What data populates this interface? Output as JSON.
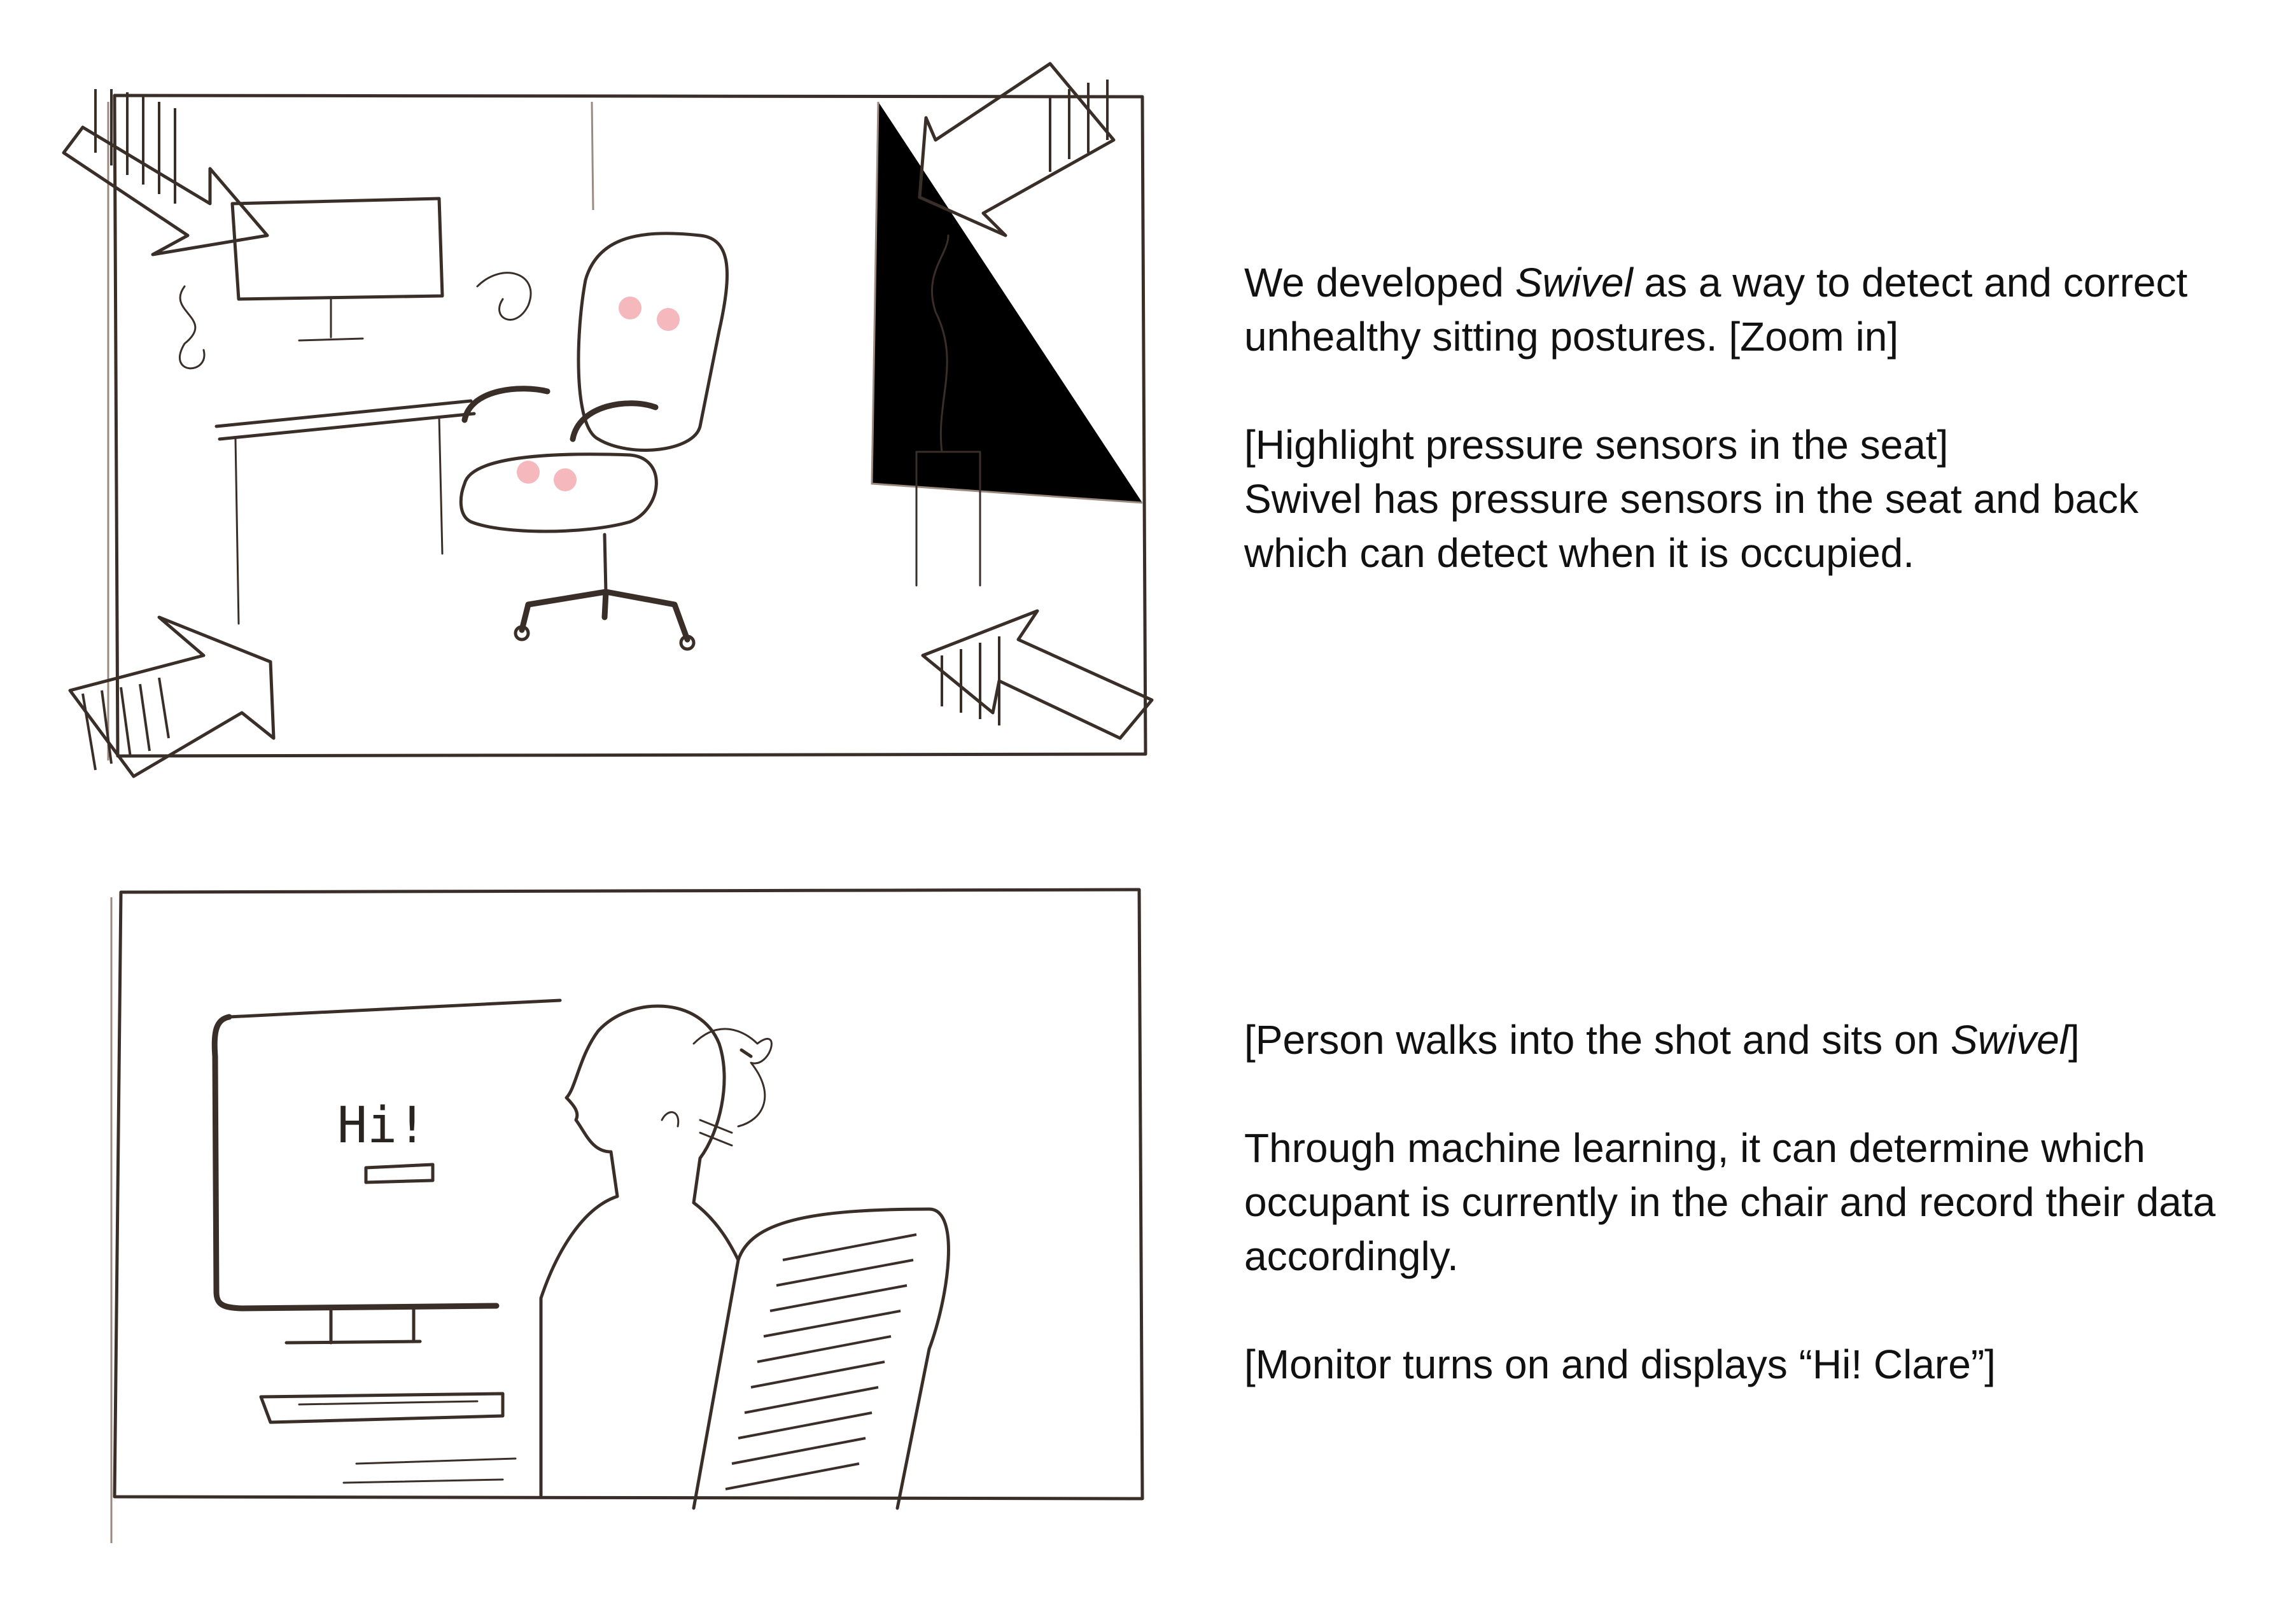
{
  "panels": [
    {
      "caption": {
        "line1_before": "We developed ",
        "line1_product": "Swivel",
        "line1_after": " as a way to detect and correct unhealthy sitting postures. [Zoom in]",
        "line2": "[Highlight pressure sensors in the seat]",
        "line3": "Swivel has pressure sensors in the seat and back which can detect when it is occupied."
      },
      "sensor_color": "#f4b8bd"
    },
    {
      "caption": {
        "line1_before": "[Person walks into the shot and sits on ",
        "line1_product": "Swivel",
        "line1_after": "]",
        "line2": "Through machine learning, it can determine which occupant is currently in the chair and record their data accordingly.",
        "line3": "[Monitor turns on and displays “Hi! Clare”]"
      },
      "monitor_text": "Hi!"
    }
  ],
  "colors": {
    "ink": "#3a2e28",
    "paper": "#ffffff"
  }
}
